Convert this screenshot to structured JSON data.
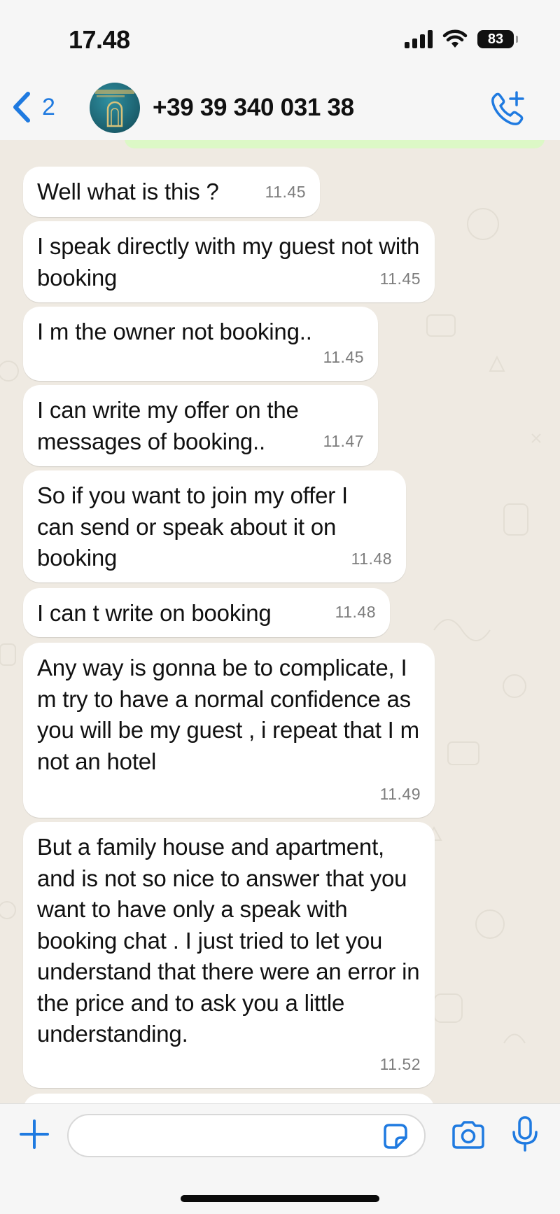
{
  "status_bar": {
    "time": "17.48",
    "battery": "83",
    "icons": [
      "signal-icon",
      "wifi-icon",
      "battery-icon"
    ]
  },
  "header": {
    "back_count": "2",
    "contact_name": "+39 39 340 031 38",
    "icons": [
      "chevron-left-icon",
      "avatar",
      "add-call-icon"
    ]
  },
  "messages": [
    {
      "text": "Well what is this ?",
      "time": "11.45"
    },
    {
      "text": "I speak directly with my guest not with booking",
      "time": "11.45"
    },
    {
      "text": "I m the owner not booking..",
      "time": "11.45"
    },
    {
      "text": "I can write my offer on the messages of booking..",
      "time": "11.47"
    },
    {
      "text": "So if you want to join my offer I can send or speak about it on booking",
      "time": "11.48"
    },
    {
      "text": "I can t write on booking",
      "time": "11.48"
    },
    {
      "text": "Any way is gonna be to complicate, I m try to have a normal confidence as you will be my guest , i repeat that I m not an hotel",
      "time": "11.49"
    },
    {
      "text": "But a family house and apartment, and is not so nice to answer that you want to have only a speak with booking chat . I just tried to let you understand that there were an error in the price and to ask you a little understanding.",
      "time": "11.52"
    }
  ],
  "input_bar": {
    "value": "",
    "placeholder": "",
    "icons": [
      "plus-icon",
      "sticker-icon",
      "camera-icon",
      "microphone-icon"
    ]
  },
  "colors": {
    "accent": "#1f7ae0",
    "chat_background": "#efeae2",
    "bubble": "#ffffff",
    "outgoing_bubble": "#dcf8c6",
    "timestamp": "#7d7d7d"
  }
}
